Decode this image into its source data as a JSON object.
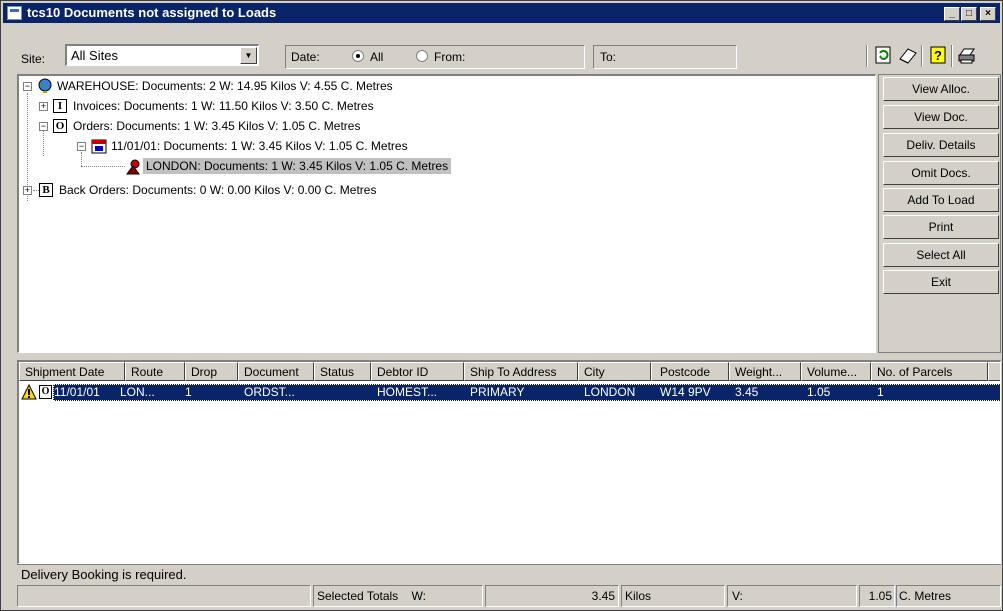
{
  "window": {
    "title": "tcs10 Documents not assigned to Loads"
  },
  "filters": {
    "site_label": "Site:",
    "site_value": "All Sites",
    "date_label": "Date:",
    "all_label": "All",
    "from_label": "From:",
    "to_label": "To:",
    "date_mode": "All"
  },
  "toolbar_icons": [
    "refresh-icon",
    "eraser-icon",
    "help-icon",
    "printer-icon"
  ],
  "tree": {
    "root": "WAREHOUSE: Documents: 2   W: 14.95 Kilos  V: 4.55 C. Metres",
    "invoices": "Invoices: Documents: 1   W: 11.50 Kilos  V: 3.50 C. Metres",
    "orders": "Orders: Documents: 1   W: 3.45 Kilos  V: 1.05 C. Metres",
    "date_node": "11/01/01: Documents: 1   W: 3.45 Kilos  V: 1.05 C. Metres",
    "london": "LONDON: Documents: 1   W: 3.45 Kilos  V: 1.05 C. Metres",
    "back_orders": "Back Orders: Documents: 0   W: 0.00 Kilos  V: 0.00 C. Metres",
    "invoices_glyph": "I",
    "orders_glyph": "O",
    "back_orders_glyph": "B"
  },
  "buttons": {
    "view_alloc": "View Alloc.",
    "view_doc": "View Doc.",
    "deliv_details": "Deliv. Details",
    "omit_docs": "Omit Docs.",
    "add_to_load": "Add To Load",
    "print": "Print",
    "select_all": "Select All",
    "exit": "Exit"
  },
  "table": {
    "columns": [
      "Shipment Date",
      "Route",
      "Drop",
      "Document",
      "Status",
      "Debtor ID",
      "Ship To Address",
      "City",
      "Postcode",
      "Weight...",
      "Volume...",
      "No. of Parcels"
    ],
    "rows": [
      [
        "11/01/01",
        "LON...",
        "1",
        "ORDST...",
        "",
        "HOMEST...",
        "PRIMARY",
        "LONDON",
        "W14 9PV",
        "3.45",
        "1.05",
        "1"
      ]
    ],
    "row_type_glyph": "O"
  },
  "status_message": "Delivery Booking is required.",
  "totals": {
    "label": "Selected Totals",
    "w_label": "W:",
    "weight": "3.45",
    "weight_unit": "Kilos",
    "v_label": "V:",
    "volume": "1.05",
    "volume_unit": "C. Metres"
  }
}
